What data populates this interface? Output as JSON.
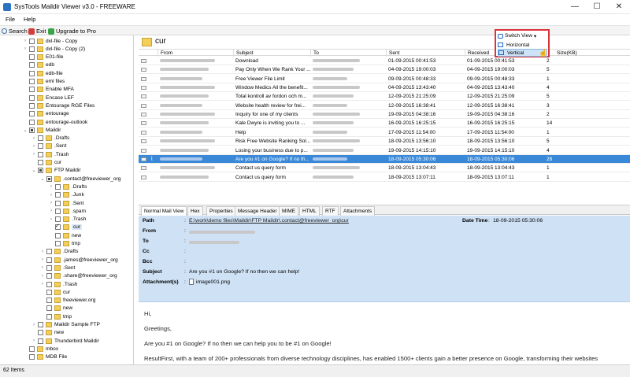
{
  "window": {
    "title": "SysTools Maildir Viewer v3.0 - FREEWARE",
    "minimize_glyph": "—",
    "maximize_glyph": "☐",
    "close_glyph": "✕"
  },
  "menu": {
    "file": "File",
    "help": "Help"
  },
  "toolbar": {
    "search": "Search",
    "exit": "Exit",
    "upgrade": "Upgrade to Pro"
  },
  "tree": {
    "items": [
      {
        "label": "dxl-file - Copy",
        "level": 3,
        "expander": "›"
      },
      {
        "label": "dxl-file - Copy (2)",
        "level": 3,
        "expander": "›"
      },
      {
        "label": "E01-file",
        "level": 3,
        "expander": ""
      },
      {
        "label": "edb",
        "level": 3,
        "expander": ""
      },
      {
        "label": "edb-file",
        "level": 3,
        "expander": ""
      },
      {
        "label": "eml files",
        "level": 3,
        "expander": ""
      },
      {
        "label": "Enable MFA",
        "level": 3,
        "expander": ""
      },
      {
        "label": "Encase LEF",
        "level": 3,
        "expander": ""
      },
      {
        "label": "Entourage RGE Files",
        "level": 3,
        "expander": ""
      },
      {
        "label": "entourage",
        "level": 3,
        "expander": ""
      },
      {
        "label": "entourage-outlook",
        "level": 3,
        "expander": ""
      },
      {
        "label": "Maildir",
        "level": 3,
        "expander": "⌄",
        "check": "partial"
      },
      {
        "label": ".Drafts",
        "level": 4,
        "expander": "›"
      },
      {
        "label": ".Sent",
        "level": 4,
        "expander": "›"
      },
      {
        "label": ".Trash",
        "level": 4,
        "expander": "›"
      },
      {
        "label": "cur",
        "level": 4,
        "expander": ""
      },
      {
        "label": "FTP Maildir",
        "level": 4,
        "expander": "⌄",
        "check": "partial"
      },
      {
        "label": ".contact@freeviewer_org",
        "level": 5,
        "expander": "⌄",
        "check": "partial"
      },
      {
        "label": ".Drafts",
        "level": 6,
        "expander": "›"
      },
      {
        "label": ".Junk",
        "level": 6,
        "expander": "›"
      },
      {
        "label": ".Sent",
        "level": 6,
        "expander": "›"
      },
      {
        "label": ".spam",
        "level": 6,
        "expander": "›"
      },
      {
        "label": ".Trash",
        "level": 6,
        "expander": "›"
      },
      {
        "label": "cur",
        "level": 6,
        "expander": "",
        "check": "checked",
        "selected": true
      },
      {
        "label": "new",
        "level": 6,
        "expander": ""
      },
      {
        "label": "tmp",
        "level": 6,
        "expander": ""
      },
      {
        "label": ".Drafts",
        "level": 5,
        "expander": "›"
      },
      {
        "label": ".james@freeviewer_org",
        "level": 5,
        "expander": "›"
      },
      {
        "label": ".Sent",
        "level": 5,
        "expander": "›"
      },
      {
        "label": ".share@freeviewer_org",
        "level": 5,
        "expander": "›"
      },
      {
        "label": ".Trash",
        "level": 5,
        "expander": "›"
      },
      {
        "label": "cur",
        "level": 5,
        "expander": ""
      },
      {
        "label": "freeviewer.org",
        "level": 5,
        "expander": ""
      },
      {
        "label": "new",
        "level": 5,
        "expander": ""
      },
      {
        "label": "tmp",
        "level": 5,
        "expander": ""
      },
      {
        "label": "Maildir Sample FTP",
        "level": 4,
        "expander": "›"
      },
      {
        "label": "new",
        "level": 4,
        "expander": ""
      },
      {
        "label": "Thunderbird Maildir",
        "level": 4,
        "expander": "›"
      },
      {
        "label": "mbox",
        "level": 3,
        "expander": ""
      },
      {
        "label": "MDB File",
        "level": 3,
        "expander": ""
      }
    ]
  },
  "folder_header": {
    "name": "cur"
  },
  "switch_view": {
    "label": "Switch View",
    "options": [
      "Horizontal",
      "Vertical"
    ],
    "hovered": "Vertical"
  },
  "grid": {
    "columns": {
      "from": "From",
      "subject": "Subject",
      "to": "To",
      "sent": "Sent",
      "received": "Received",
      "size": "Size(KB)"
    },
    "rows": [
      {
        "subject": "Download",
        "sent": "01-09-2015 00:41:53",
        "received": "01-09-2015 00:41:53",
        "size": "2"
      },
      {
        "subject": "Pay Only When We Rank Your ...",
        "sent": "04-09-2015 19:00:03",
        "received": "04-09-2015 19:00:03",
        "size": "5"
      },
      {
        "subject": "Free Viewer File Limit",
        "sent": "09-09-2015 00:48:33",
        "received": "09-09-2015 00:48:33",
        "size": "1"
      },
      {
        "subject": "Window Medics All the benefit...",
        "sent": "04-09-2015 13:43:40",
        "received": "04-09-2015 13:43:40",
        "size": "4"
      },
      {
        "subject": "Total kontroll av fordon och m...",
        "sent": "12-09-2015 21:25:09",
        "received": "12-09-2015 21:25:09",
        "size": "5"
      },
      {
        "subject": "Website health review for frei...",
        "sent": "12-09-2015 16:38:41",
        "received": "12-09-2015 16:38:41",
        "size": "3"
      },
      {
        "subject": "Inquiry for one of my clients",
        "sent": "19-09-2015 04:38:16",
        "received": "19-09-2015 04:38:16",
        "size": "2"
      },
      {
        "subject": "Kale Dwyre is inviting you to ...",
        "sent": "16-09-2015 16:25:15",
        "received": "16-09-2015 16:25:15",
        "size": "14"
      },
      {
        "subject": "Help",
        "sent": "17-09-2015 11:54:00",
        "received": "17-09-2015 11:54:00",
        "size": "1"
      },
      {
        "subject": "Risk Free Website Ranking Sol...",
        "sent": "18-09-2015 13:56:10",
        "received": "18-09-2015 13:56:10",
        "size": "5"
      },
      {
        "subject": "Losing your business due to p...",
        "sent": "19-09-2015 14:15:10",
        "received": "19-09-2015 14:15:10",
        "size": "4"
      },
      {
        "subject": "Are you #1 on Google? If no th...",
        "sent": "18-09-2015 05:30:06",
        "received": "18-09-2015 05:30:06",
        "size": "28",
        "selected": true,
        "attachment": true
      },
      {
        "subject": "Contact us query form",
        "sent": "18-09-2015 13:04:43",
        "received": "18-09-2015 13:04:43",
        "size": "1"
      },
      {
        "subject": "Contact us query form",
        "sent": "18-09-2015 13:07:11",
        "received": "18-09-2015 13:07:11",
        "size": "1"
      }
    ]
  },
  "tabs": [
    "Normal Mail View",
    "Hex",
    "Properties",
    "Message Header",
    "MIME",
    "HTML",
    "RTF",
    "Attachments"
  ],
  "meta": {
    "path_label": "Path",
    "path_value": "E:\\work\\demo files\\Maildir\\FTP Maildir\\.contact@freeviewer_org\\cur",
    "from_label": "From",
    "to_label": "To",
    "cc_label": "Cc",
    "bcc_label": "Bcc",
    "subject_label": "Subject",
    "subject_value": "Are you #1 on Google? If no then we can help!",
    "attachments_label": "Attachment(s)",
    "attachment_file": "image001.png",
    "datetime_label": "Date Time",
    "datetime_value": "18-09-2015 05:30:06",
    "colon": ":"
  },
  "body": {
    "lines": [
      "Hi,",
      "Greetings,",
      "Are you #1 on Google? If no then we can help you to be #1 on Google!",
      "ResultFirst, with a team of 200+ professionals from diverse technology disciplines, has enabled 1500+ clients gain a better presence on Google, transforming their websites"
    ]
  },
  "status": {
    "items": "62 Items"
  },
  "colors": {
    "selection": "#3a89d8",
    "meta_bg": "#cfe1f5",
    "highlight_box": "#d9343a"
  }
}
